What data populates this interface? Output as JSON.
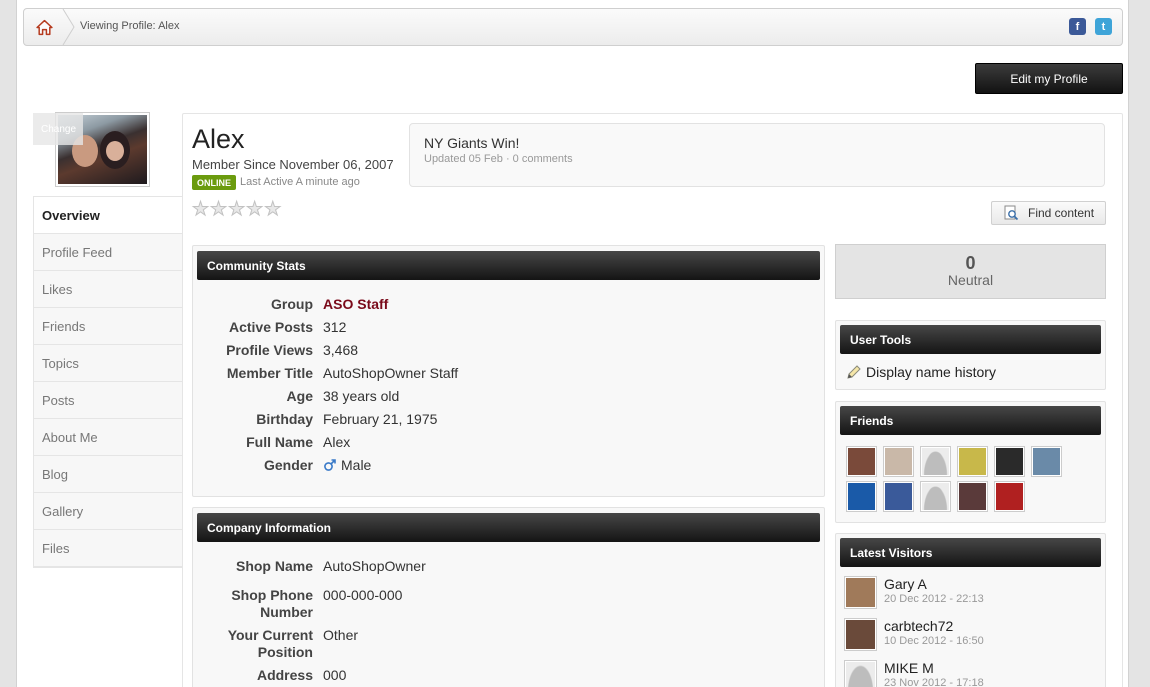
{
  "breadcrumb": {
    "current": "Viewing Profile: Alex"
  },
  "social": {
    "facebook_glyph": "f",
    "twitter_glyph": "t"
  },
  "header": {
    "edit_profile_label": "Edit my Profile",
    "change_photo_label": "Change"
  },
  "profile": {
    "name": "Alex",
    "member_since": "Member Since November 06, 2007",
    "online_badge": "ONLINE",
    "last_active": "Last Active A minute ago",
    "rating_stars": 5,
    "rating_value": 0
  },
  "status_update": {
    "title": "NY Giants Win!",
    "meta": "Updated 05 Feb · 0 comments"
  },
  "find_content_label": "Find content",
  "sidebar": {
    "items": [
      {
        "label": "Overview",
        "active": true
      },
      {
        "label": "Profile Feed",
        "active": false
      },
      {
        "label": "Likes",
        "active": false
      },
      {
        "label": "Friends",
        "active": false
      },
      {
        "label": "Topics",
        "active": false
      },
      {
        "label": "Posts",
        "active": false
      },
      {
        "label": "About Me",
        "active": false
      },
      {
        "label": "Blog",
        "active": false
      },
      {
        "label": "Gallery",
        "active": false
      },
      {
        "label": "Files",
        "active": false
      }
    ]
  },
  "community_stats": {
    "title": "Community Stats",
    "rows": [
      {
        "key": "Group",
        "value": "ASO Staff"
      },
      {
        "key": "Active Posts",
        "value": "312"
      },
      {
        "key": "Profile Views",
        "value": "3,468"
      },
      {
        "key": "Member Title",
        "value": "AutoShopOwner Staff"
      },
      {
        "key": "Age",
        "value": "38 years old"
      },
      {
        "key": "Birthday",
        "value": "February 21, 1975"
      },
      {
        "key": "Full Name",
        "value": "Alex"
      },
      {
        "key": "Gender",
        "value": "Male"
      }
    ]
  },
  "company_info": {
    "title": "Company Information",
    "rows": [
      {
        "key": "Shop Name",
        "value": "AutoShopOwner"
      },
      {
        "key": "Shop Phone Number",
        "value": "000-000-000"
      },
      {
        "key": "Your Current Position",
        "value": "Other"
      },
      {
        "key": "Address",
        "value": "000"
      }
    ]
  },
  "reputation": {
    "value": "0",
    "label": "Neutral"
  },
  "user_tools": {
    "title": "User Tools",
    "link": "Display name history"
  },
  "friends": {
    "title": "Friends",
    "avatar_colors": [
      "#7a4a3a",
      "#c9b8a8",
      "#d8d8d8",
      "#c8b84a",
      "#2a2a2a",
      "#6a8aa8",
      "#1a5aa8",
      "#3a5a9a",
      "#d8d8d8",
      "#5a3a3a",
      "#b02020"
    ]
  },
  "latest_visitors": {
    "title": "Latest Visitors",
    "items": [
      {
        "name": "Gary A",
        "date": "20 Dec 2012 - 22:13",
        "color": "#a07a5a"
      },
      {
        "name": "carbtech72",
        "date": "10 Dec 2012 - 16:50",
        "color": "#6a4a3a"
      },
      {
        "name": "MIKE M",
        "date": "23 Nov 2012 - 17:18",
        "color": "#d8d8d8"
      }
    ]
  }
}
